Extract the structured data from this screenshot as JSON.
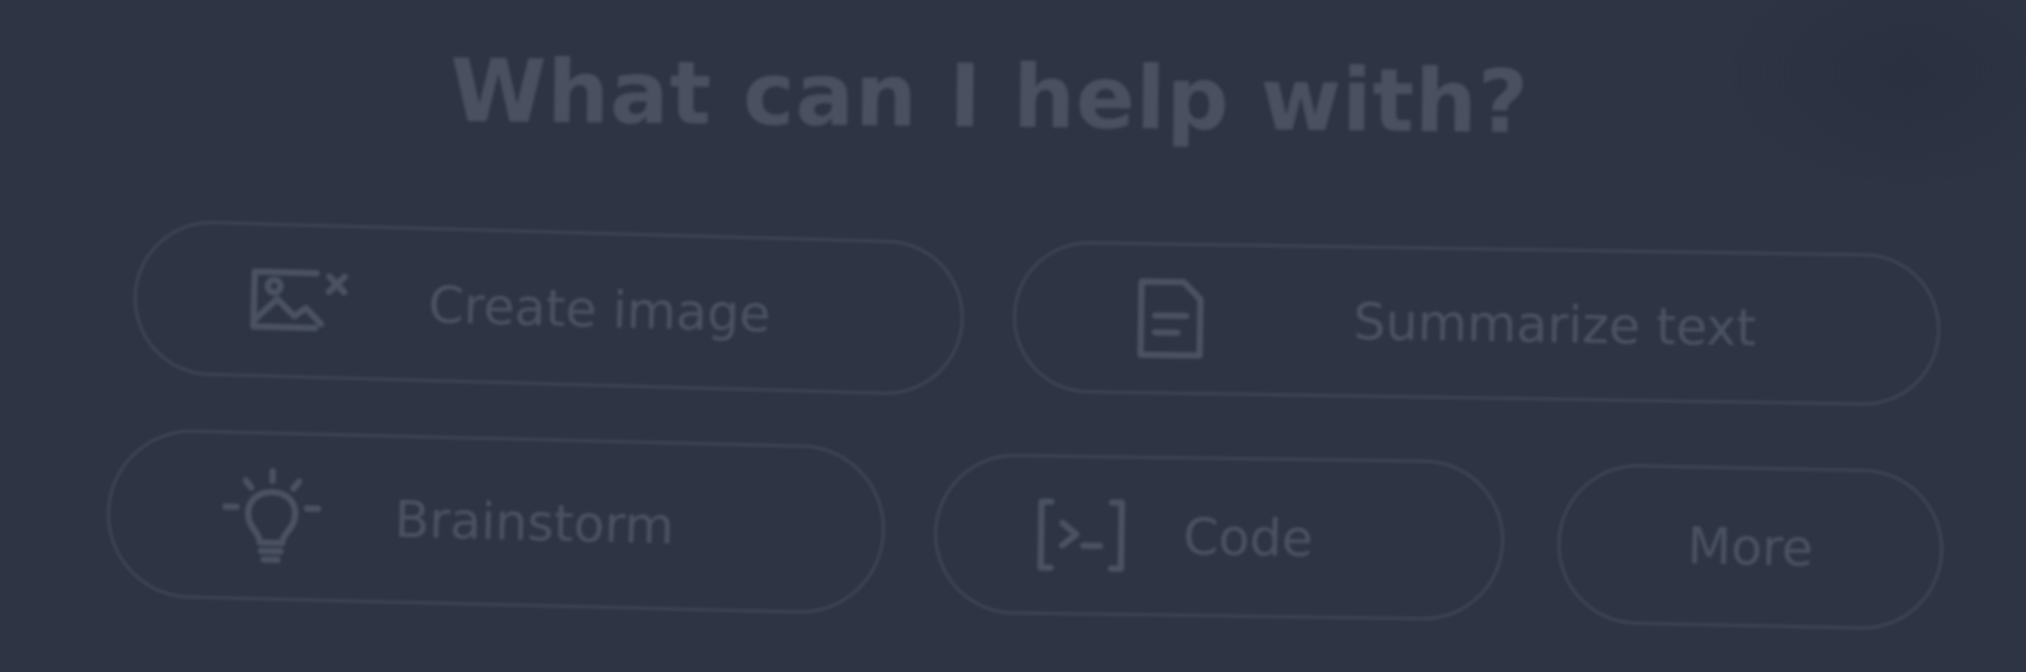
{
  "prompt": {
    "title": "What can I help with?"
  },
  "suggestions": [
    {
      "label": "Create image",
      "icon": "image-icon"
    },
    {
      "label": "Summarize text",
      "icon": "document-icon"
    },
    {
      "label": "Brainstorm",
      "icon": "lightbulb-icon"
    },
    {
      "label": "Code",
      "icon": "code-icon"
    },
    {
      "label": "More"
    }
  ],
  "colors": {
    "background": "#2e3444",
    "title_text": "#4a5060",
    "pill_border": "#3f4657",
    "pill_text": "#4b5262"
  }
}
